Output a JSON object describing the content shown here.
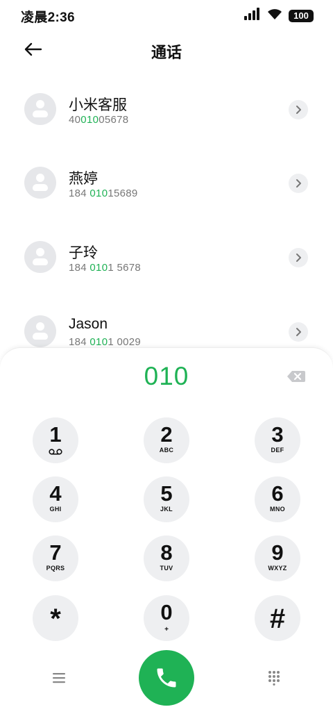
{
  "status_bar": {
    "time": "凌晨2:36",
    "battery": "100"
  },
  "header": {
    "title": "通话"
  },
  "contacts": [
    {
      "name": "小米客服",
      "number_parts": [
        "40",
        "010",
        "05678"
      ]
    },
    {
      "name": "燕婷",
      "number_parts": [
        "184 ",
        "010",
        "15689"
      ]
    },
    {
      "name": "子玲",
      "number_parts": [
        "184 ",
        "010",
        "1 5678"
      ]
    },
    {
      "name": "Jason",
      "number_parts": [
        "184 ",
        "010",
        "1 0029"
      ]
    }
  ],
  "dialpad": {
    "entered": "010",
    "keys": [
      {
        "digit": "1",
        "letters": ""
      },
      {
        "digit": "2",
        "letters": "ABC"
      },
      {
        "digit": "3",
        "letters": "DEF"
      },
      {
        "digit": "4",
        "letters": "GHI"
      },
      {
        "digit": "5",
        "letters": "JKL"
      },
      {
        "digit": "6",
        "letters": "MNO"
      },
      {
        "digit": "7",
        "letters": "PQRS"
      },
      {
        "digit": "8",
        "letters": "TUV"
      },
      {
        "digit": "9",
        "letters": "WXYZ"
      },
      {
        "digit": "*",
        "letters": ""
      },
      {
        "digit": "0",
        "letters": "+"
      },
      {
        "digit": "#",
        "letters": ""
      }
    ]
  },
  "colors": {
    "accent": "#1fb255",
    "key_bg": "#eeeff1",
    "avatar_bg": "#e6e7ea"
  },
  "icons": [
    "signal-icon",
    "wifi-icon",
    "battery-icon",
    "back-arrow-icon",
    "avatar-icon",
    "chevron-right-icon",
    "backspace-icon",
    "voicemail-icon",
    "menu-icon",
    "phone-icon",
    "dialpad-icon"
  ]
}
